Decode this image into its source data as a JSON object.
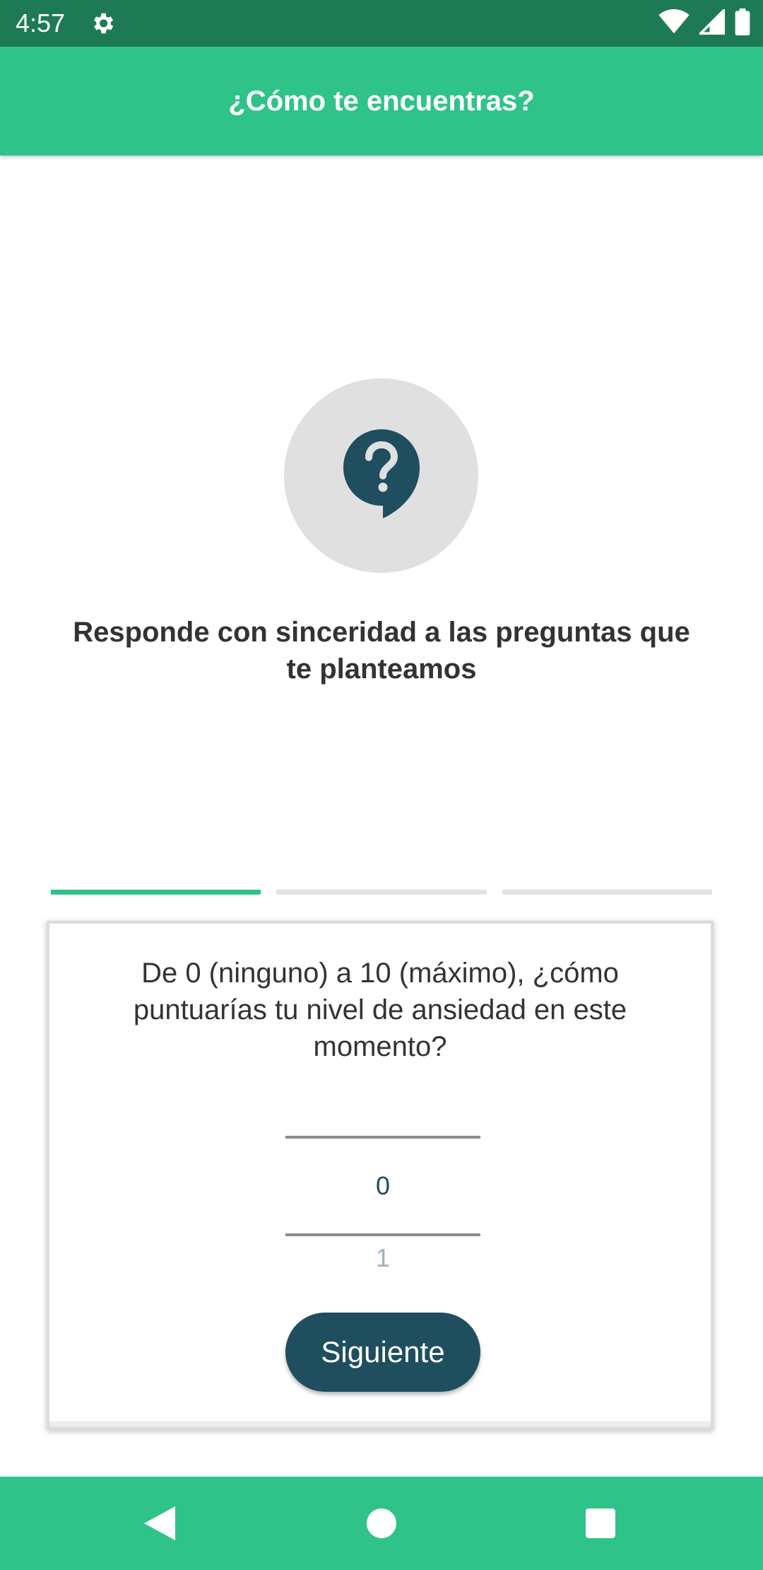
{
  "status_bar": {
    "time": "4:57",
    "icons": [
      "gear-icon",
      "wifi-icon",
      "signal-icon",
      "battery-icon"
    ]
  },
  "app_bar": {
    "title": "¿Cómo te encuentras?"
  },
  "hero": {
    "icon": "question-bubble-icon",
    "text": "Responde con sinceridad a las preguntas que te planteamos"
  },
  "progress": {
    "total_steps": 3,
    "current_step": 1
  },
  "card": {
    "question": "De 0 (ninguno) a 10 (máximo), ¿cómo puntuarías tu nivel de ansiedad en este momento?",
    "picker": {
      "selected_value": "0",
      "next_value": "1"
    },
    "next_button_label": "Siguiente"
  },
  "nav_bar": {
    "buttons": [
      "back-icon",
      "home-icon",
      "recents-icon"
    ]
  },
  "colors": {
    "primary_green": "#2fc389",
    "status_green": "#1e7a55",
    "dark_teal": "#1f4e5f"
  }
}
